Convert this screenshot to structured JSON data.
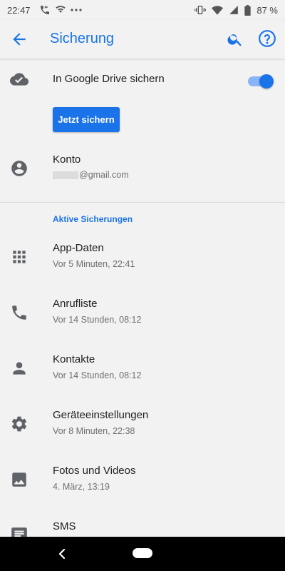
{
  "status": {
    "time": "22:47",
    "battery": "87 %"
  },
  "appbar": {
    "title": "Sicherung"
  },
  "backup": {
    "label": "In Google Drive sichern",
    "enabled": true,
    "button": "Jetzt sichern"
  },
  "account": {
    "label": "Konto",
    "email_suffix": "@gmail.com"
  },
  "section": {
    "title": "Aktive Sicherungen"
  },
  "items": [
    {
      "label": "App-Daten",
      "time": "Vor 5 Minuten, 22:41",
      "icon": "apps-grid-icon"
    },
    {
      "label": "Anrufliste",
      "time": "Vor 14 Stunden, 08:12",
      "icon": "phone-icon"
    },
    {
      "label": "Kontakte",
      "time": "Vor 14 Stunden, 08:12",
      "icon": "person-icon"
    },
    {
      "label": "Geräteeinstellungen",
      "time": "Vor 8 Minuten, 22:38",
      "icon": "settings-gear-icon"
    },
    {
      "label": "Fotos und Videos",
      "time": "4. März, 13:19",
      "icon": "image-icon"
    },
    {
      "label": "SMS",
      "time": "",
      "icon": "message-icon"
    }
  ],
  "colors": {
    "accent": "#1a73e8",
    "background": "#f2f2f2"
  }
}
